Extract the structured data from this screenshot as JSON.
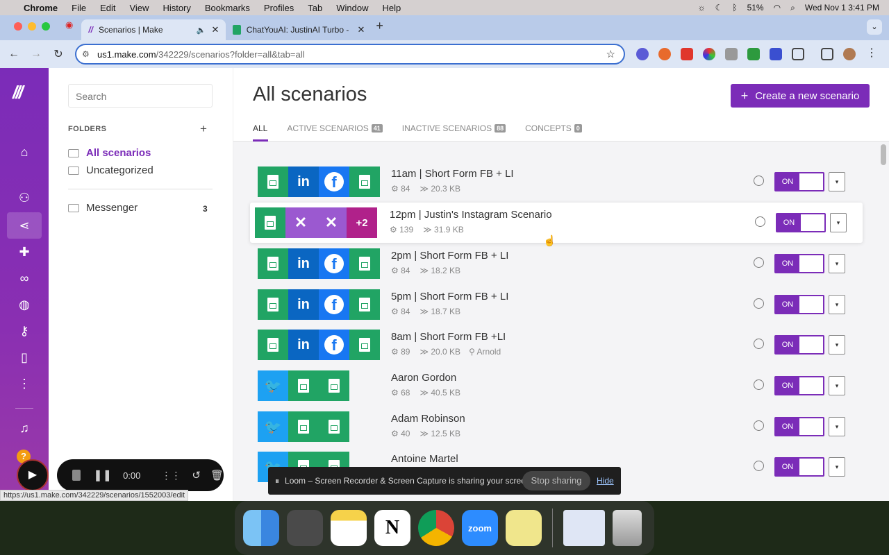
{
  "menubar": {
    "app": "Chrome",
    "items": [
      "File",
      "Edit",
      "View",
      "History",
      "Bookmarks",
      "Profiles",
      "Tab",
      "Window",
      "Help"
    ],
    "battery": "51%",
    "clock": "Wed Nov 1  3:41 PM"
  },
  "tabs": [
    {
      "title": "Scenarios | Make"
    },
    {
      "title": "ChatYouAI: JustinAI Turbo - C"
    }
  ],
  "address": {
    "host": "us1.make.com",
    "path": "/342229/scenarios?folder=all&tab=all"
  },
  "sidebar": {
    "search_placeholder": "Search",
    "folders_heading": "FOLDERS",
    "folders": [
      {
        "label": "All scenarios"
      },
      {
        "label": "Uncategorized"
      },
      {
        "label": "Messenger",
        "count": "3"
      }
    ]
  },
  "page": {
    "title": "All scenarios",
    "create_label": "Create a new scenario",
    "tabs": [
      {
        "label": "ALL",
        "count": ""
      },
      {
        "label": "ACTIVE SCENARIOS",
        "count": "41"
      },
      {
        "label": "INACTIVE SCENARIOS",
        "count": "88"
      },
      {
        "label": "CONCEPTS",
        "count": "0"
      }
    ]
  },
  "scenarios": [
    {
      "name": "11am | Short Form FB + LI",
      "ops": "84",
      "size": "20.3 KB",
      "author": "",
      "toggle": "ON"
    },
    {
      "name": "12pm | Justin's Instagram Scenario",
      "ops": "139",
      "size": "31.9 KB",
      "author": "",
      "toggle": "ON",
      "more": "+2"
    },
    {
      "name": "2pm | Short Form FB + LI",
      "ops": "84",
      "size": "18.2 KB",
      "author": "",
      "toggle": "ON"
    },
    {
      "name": "5pm | Short Form FB + LI",
      "ops": "84",
      "size": "18.7 KB",
      "author": "",
      "toggle": "ON"
    },
    {
      "name": "8am | Short Form FB +LI",
      "ops": "89",
      "size": "20.0 KB",
      "author": "Arnold",
      "toggle": "ON"
    },
    {
      "name": "Aaron Gordon",
      "ops": "68",
      "size": "40.5 KB",
      "author": "",
      "toggle": "ON"
    },
    {
      "name": "Adam Robinson",
      "ops": "40",
      "size": "12.5 KB",
      "author": "",
      "toggle": "ON"
    },
    {
      "name": "Antoine Martel",
      "ops": "",
      "size": "",
      "author": "",
      "toggle": "ON"
    }
  ],
  "loom": {
    "message": "Loom – Screen Recorder & Screen Capture is sharing your screen.",
    "stop": "Stop sharing",
    "hide": "Hide"
  },
  "recorder": {
    "time": "0:00"
  },
  "statusbar": {
    "url": "https://us1.make.com/342229/scenarios/1552003/edit"
  },
  "dock": {
    "zoom_label": "zoom"
  },
  "colors": {
    "brand": "#7b2cb8",
    "sheets": "#21a464",
    "linkedin": "#0a66c2",
    "facebook": "#1877f2",
    "twitter": "#1da1f2"
  }
}
